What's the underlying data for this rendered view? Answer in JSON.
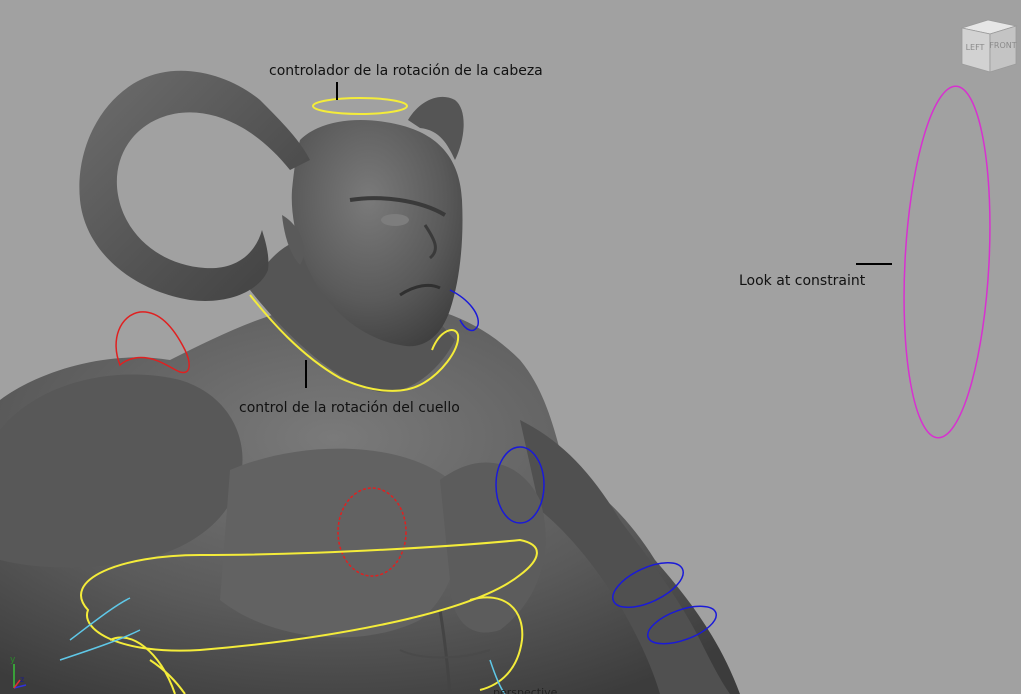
{
  "viewport": {
    "annotations": {
      "head": "controlador de la rotación de la cabeza",
      "neck": "control de la rotación del cuello",
      "look_at": "Look at constraint"
    },
    "viewcube": {
      "left": "LEFT",
      "front": "FRONT"
    },
    "axis": {
      "y": "y",
      "z": "z"
    },
    "hud_partial": "perspective"
  },
  "colors": {
    "background": "#a1a1a1",
    "mesh": "#5f5f5f",
    "yellow_control": "#f4ec3a",
    "red_control": "#e02020",
    "blue_control": "#1a1ad8",
    "magenta_locator": "#d830d0",
    "cyan_control": "#5fc8e8"
  }
}
